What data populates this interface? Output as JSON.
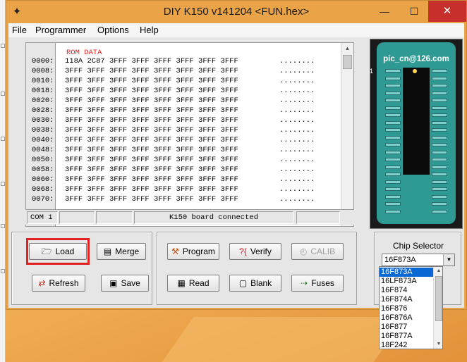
{
  "window": {
    "title": "DIY K150 v141204  <FUN.hex>",
    "minimize": "—",
    "maximize": "☐",
    "close": "✕"
  },
  "menu": [
    "File",
    "Programmer",
    "Options",
    "Help"
  ],
  "hex": {
    "header": "ROM DATA",
    "rows": [
      {
        "addr": "0000:",
        "data": "118A 2C87 3FFF 3FFF 3FFF 3FFF 3FFF 3FFF",
        "ascii": "........"
      },
      {
        "addr": "0008:",
        "data": "3FFF 3FFF 3FFF 3FFF 3FFF 3FFF 3FFF 3FFF",
        "ascii": "........"
      },
      {
        "addr": "0010:",
        "data": "3FFF 3FFF 3FFF 3FFF 3FFF 3FFF 3FFF 3FFF",
        "ascii": "........"
      },
      {
        "addr": "0018:",
        "data": "3FFF 3FFF 3FFF 3FFF 3FFF 3FFF 3FFF 3FFF",
        "ascii": "........"
      },
      {
        "addr": "0020:",
        "data": "3FFF 3FFF 3FFF 3FFF 3FFF 3FFF 3FFF 3FFF",
        "ascii": "........"
      },
      {
        "addr": "0028:",
        "data": "3FFF 3FFF 3FFF 3FFF 3FFF 3FFF 3FFF 3FFF",
        "ascii": "........"
      },
      {
        "addr": "0030:",
        "data": "3FFF 3FFF 3FFF 3FFF 3FFF 3FFF 3FFF 3FFF",
        "ascii": "........"
      },
      {
        "addr": "0038:",
        "data": "3FFF 3FFF 3FFF 3FFF 3FFF 3FFF 3FFF 3FFF",
        "ascii": "........"
      },
      {
        "addr": "0040:",
        "data": "3FFF 3FFF 3FFF 3FFF 3FFF 3FFF 3FFF 3FFF",
        "ascii": "........"
      },
      {
        "addr": "0048:",
        "data": "3FFF 3FFF 3FFF 3FFF 3FFF 3FFF 3FFF 3FFF",
        "ascii": "........"
      },
      {
        "addr": "0050:",
        "data": "3FFF 3FFF 3FFF 3FFF 3FFF 3FFF 3FFF 3FFF",
        "ascii": "........"
      },
      {
        "addr": "0058:",
        "data": "3FFF 3FFF 3FFF 3FFF 3FFF 3FFF 3FFF 3FFF",
        "ascii": "........"
      },
      {
        "addr": "0060:",
        "data": "3FFF 3FFF 3FFF 3FFF 3FFF 3FFF 3FFF 3FFF",
        "ascii": "........"
      },
      {
        "addr": "0068:",
        "data": "3FFF 3FFF 3FFF 3FFF 3FFF 3FFF 3FFF 3FFF",
        "ascii": "........"
      },
      {
        "addr": "0070:",
        "data": "3FFF 3FFF 3FFF 3FFF 3FFF 3FFF 3FFF 3FFF",
        "ascii": "........"
      }
    ]
  },
  "status": {
    "port": "COM 1",
    "message": "K150 board connected"
  },
  "chip_view": {
    "email": "pic_cn@126.com",
    "pin1_label": "1"
  },
  "buttons": {
    "load": "Load",
    "merge": "Merge",
    "refresh": "Refresh",
    "save": "Save",
    "program": "Program",
    "verify": "Verify",
    "calib": "CALIB",
    "read": "Read",
    "blank": "Blank",
    "fuses": "Fuses"
  },
  "chip_selector": {
    "label": "Chip Selector",
    "selected": "16F873A",
    "options": [
      "16F873A",
      "16LF873A",
      "16F874",
      "16F874A",
      "16F876",
      "16F876A",
      "16F877",
      "16F877A",
      "18F242"
    ]
  },
  "colors": {
    "title_bg": "#eaa447",
    "close_btn": "#c7302a",
    "highlight": "#e12020",
    "selection": "#0a68d4",
    "rom_header": "#e02020",
    "chip_board": "#2f9a93"
  }
}
